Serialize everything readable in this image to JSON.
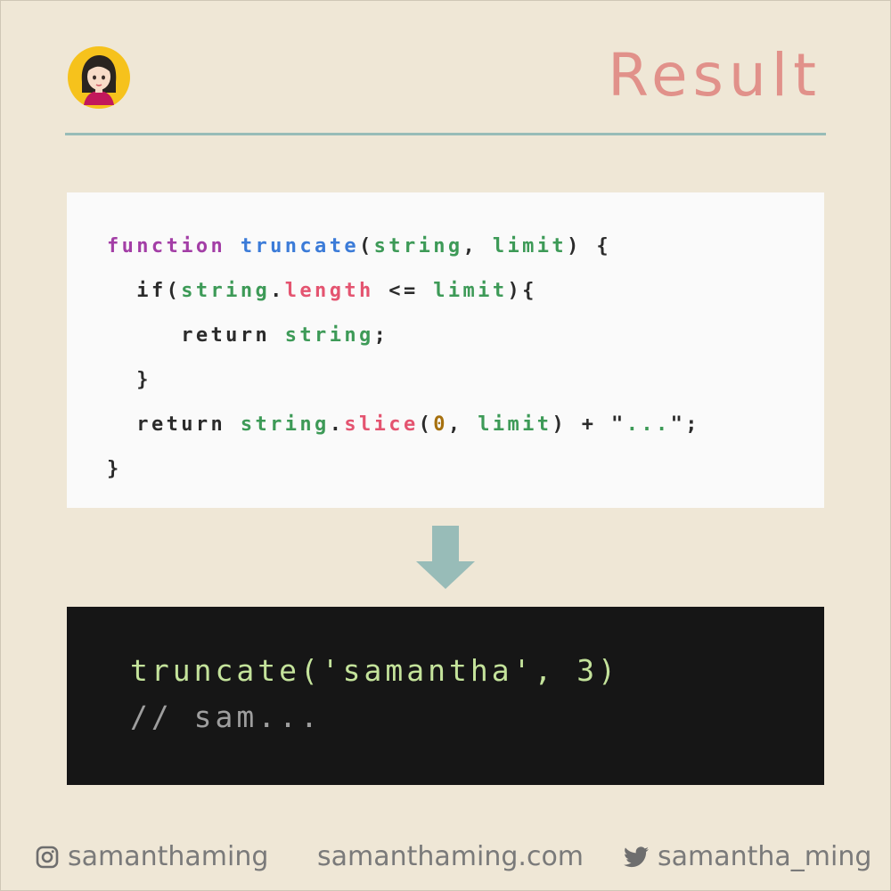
{
  "header": {
    "title": "Result",
    "accent_color": "#e1918a",
    "rule_color": "#98bcb8",
    "avatar_icon": "avatar-icon"
  },
  "code_block": {
    "tokens": {
      "keyword_function": "function",
      "function_name": "truncate",
      "paren_open": "(",
      "param_string": "string",
      "comma": ",",
      "param_limit": "limit",
      "brace_sig": ") {",
      "if_kw": "if(",
      "if_string": "string",
      "dot": ".",
      "length": "length",
      "lte": "<=",
      "if_limit": "limit",
      "if_close": "){",
      "return_kw": "return",
      "return_string": "string",
      "semicolon": ";",
      "close_brace_inner": "}",
      "return2_kw": "return",
      "return2_string": "string",
      "slice": "slice",
      "slice_open": "(",
      "zero": "0",
      "slice_comma": ",",
      "slice_limit": "limit",
      "slice_close_plus": ") + \"",
      "ellipsis": "...",
      "end_quote_semi": "\";",
      "close_brace_outer": "}"
    }
  },
  "arrow_icon": "arrow-down-icon",
  "console": {
    "call": "truncate('samantha', 3)",
    "result": "// sam..."
  },
  "footer": {
    "instagram_icon": "instagram-icon",
    "instagram": "samanthaming",
    "website": "samanthaming.com",
    "twitter_icon": "twitter-icon",
    "twitter": "samantha_ming"
  }
}
